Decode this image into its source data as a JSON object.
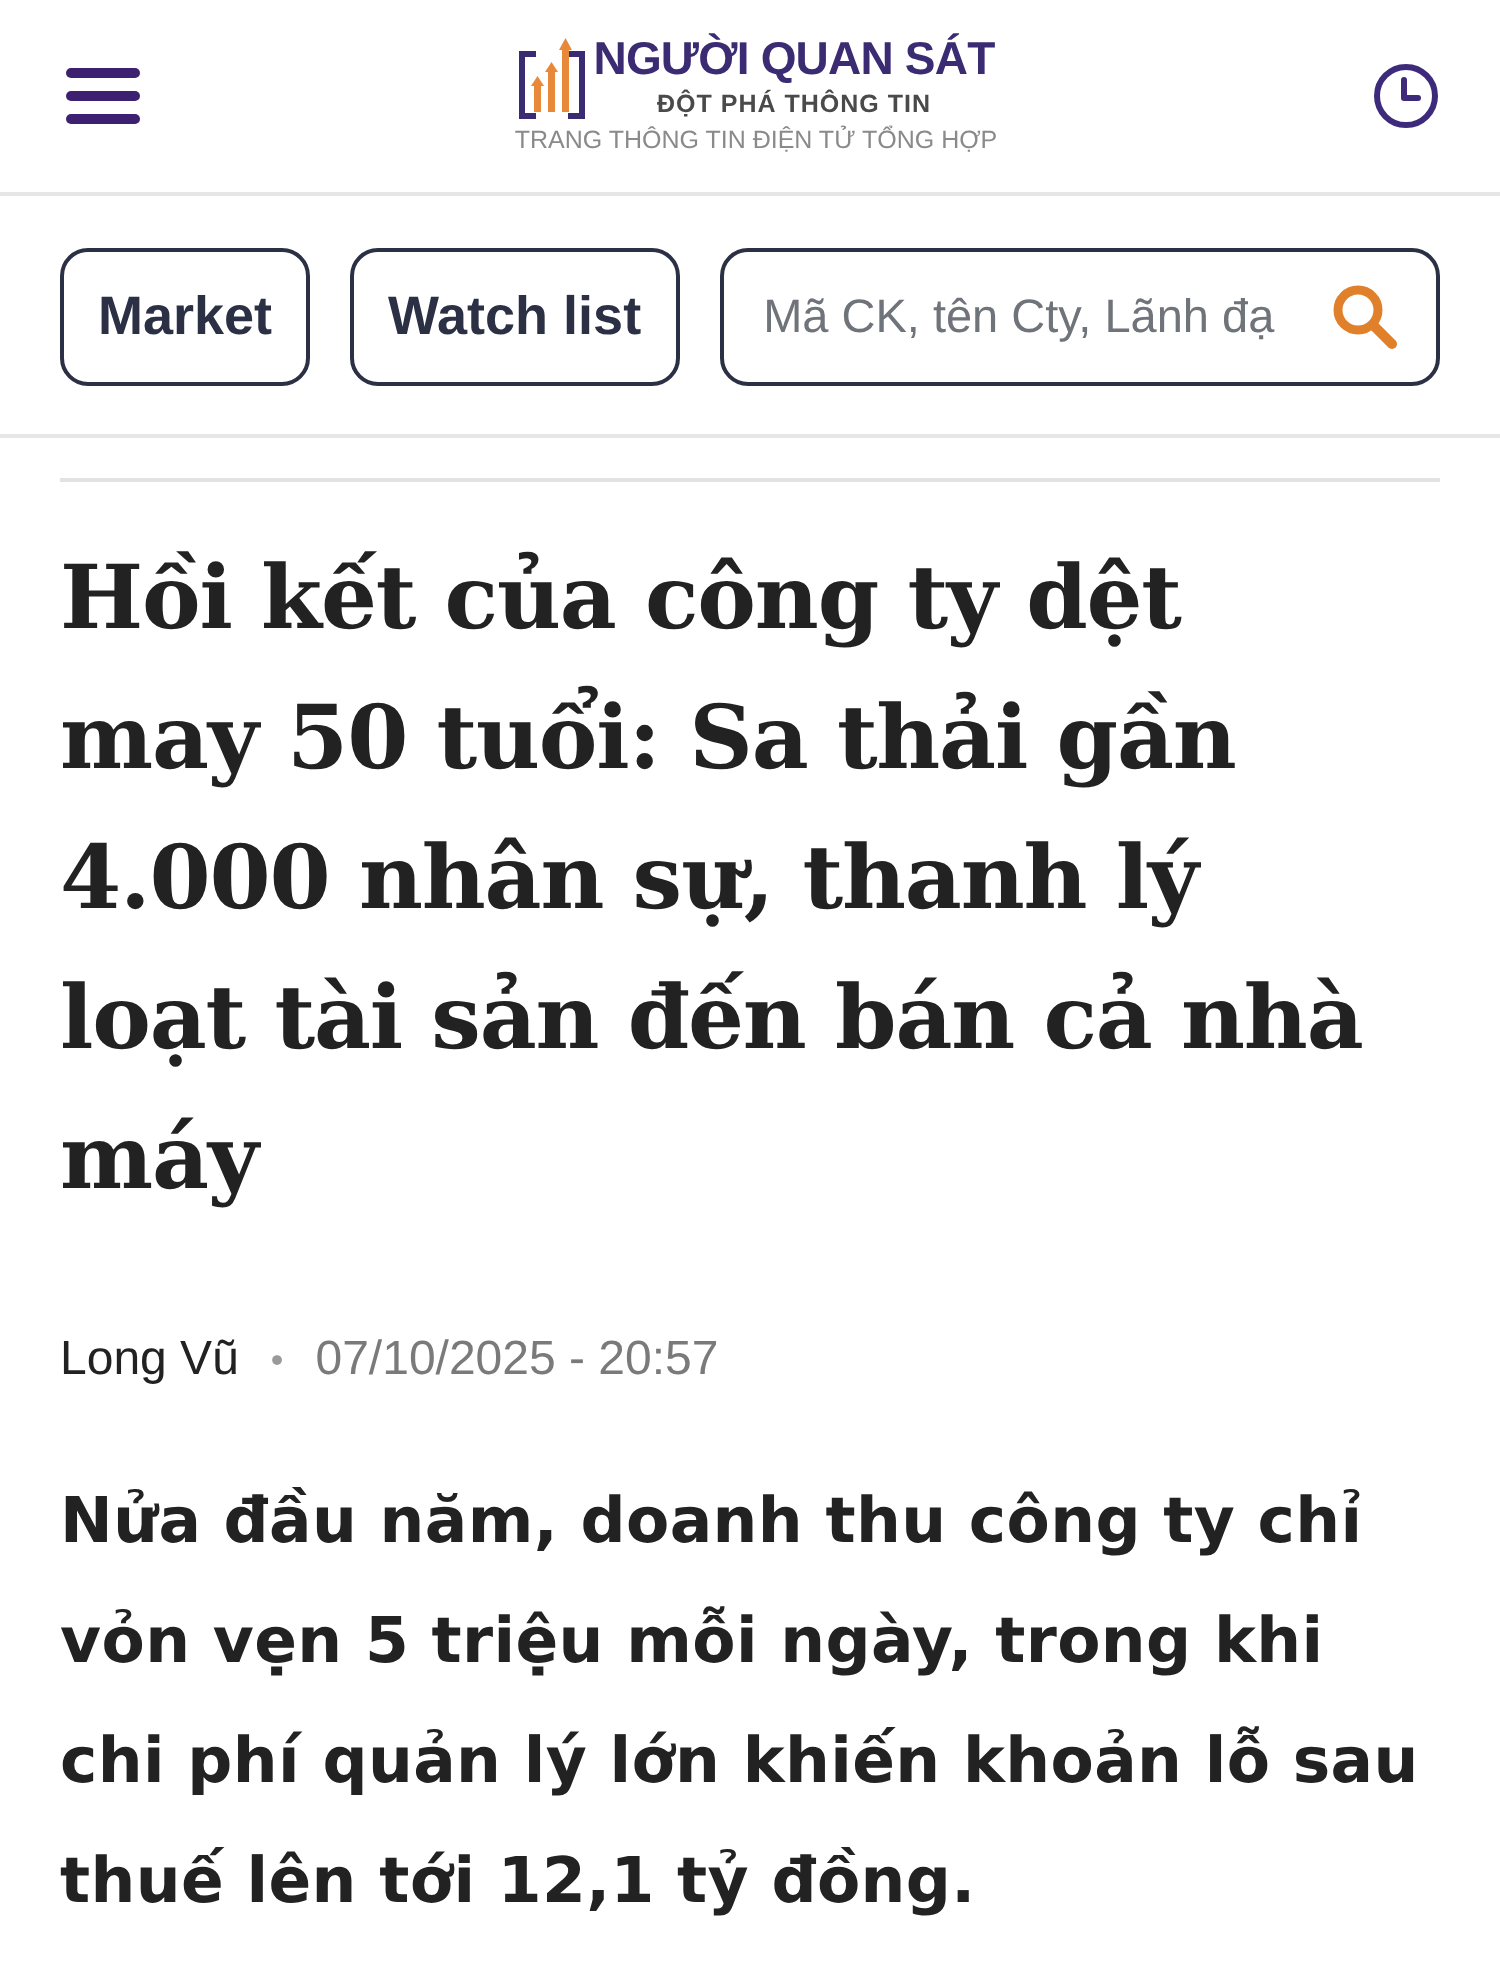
{
  "header": {
    "logo": {
      "name": "NGƯỜI QUAN SÁT",
      "tagline": "ĐỘT PHÁ THÔNG TIN",
      "subtitle": "TRANG THÔNG TIN ĐIỆN TỬ TỔNG HỢP"
    }
  },
  "toolbar": {
    "buttons": [
      "Market",
      "Watch list"
    ],
    "search": {
      "placeholder": "Mã CK, tên Cty, Lãnh đạ"
    }
  },
  "article": {
    "title": "Hồi kết của công ty dệt may 50 tuổi: Sa thải gần 4.000 nhân sự, thanh lý loạt tài sản đến bán cả nhà máy",
    "author": "Long Vũ",
    "separator": "•",
    "date": "07/10/2025 - 20:57",
    "summary": "Nửa đầu năm, doanh thu công ty chỉ vỏn vẹn 5 triệu mỗi ngày, trong khi chi phí quản lý lớn khiến khoản lỗ sau thuế lên tới 12,1 tỷ đồng."
  }
}
